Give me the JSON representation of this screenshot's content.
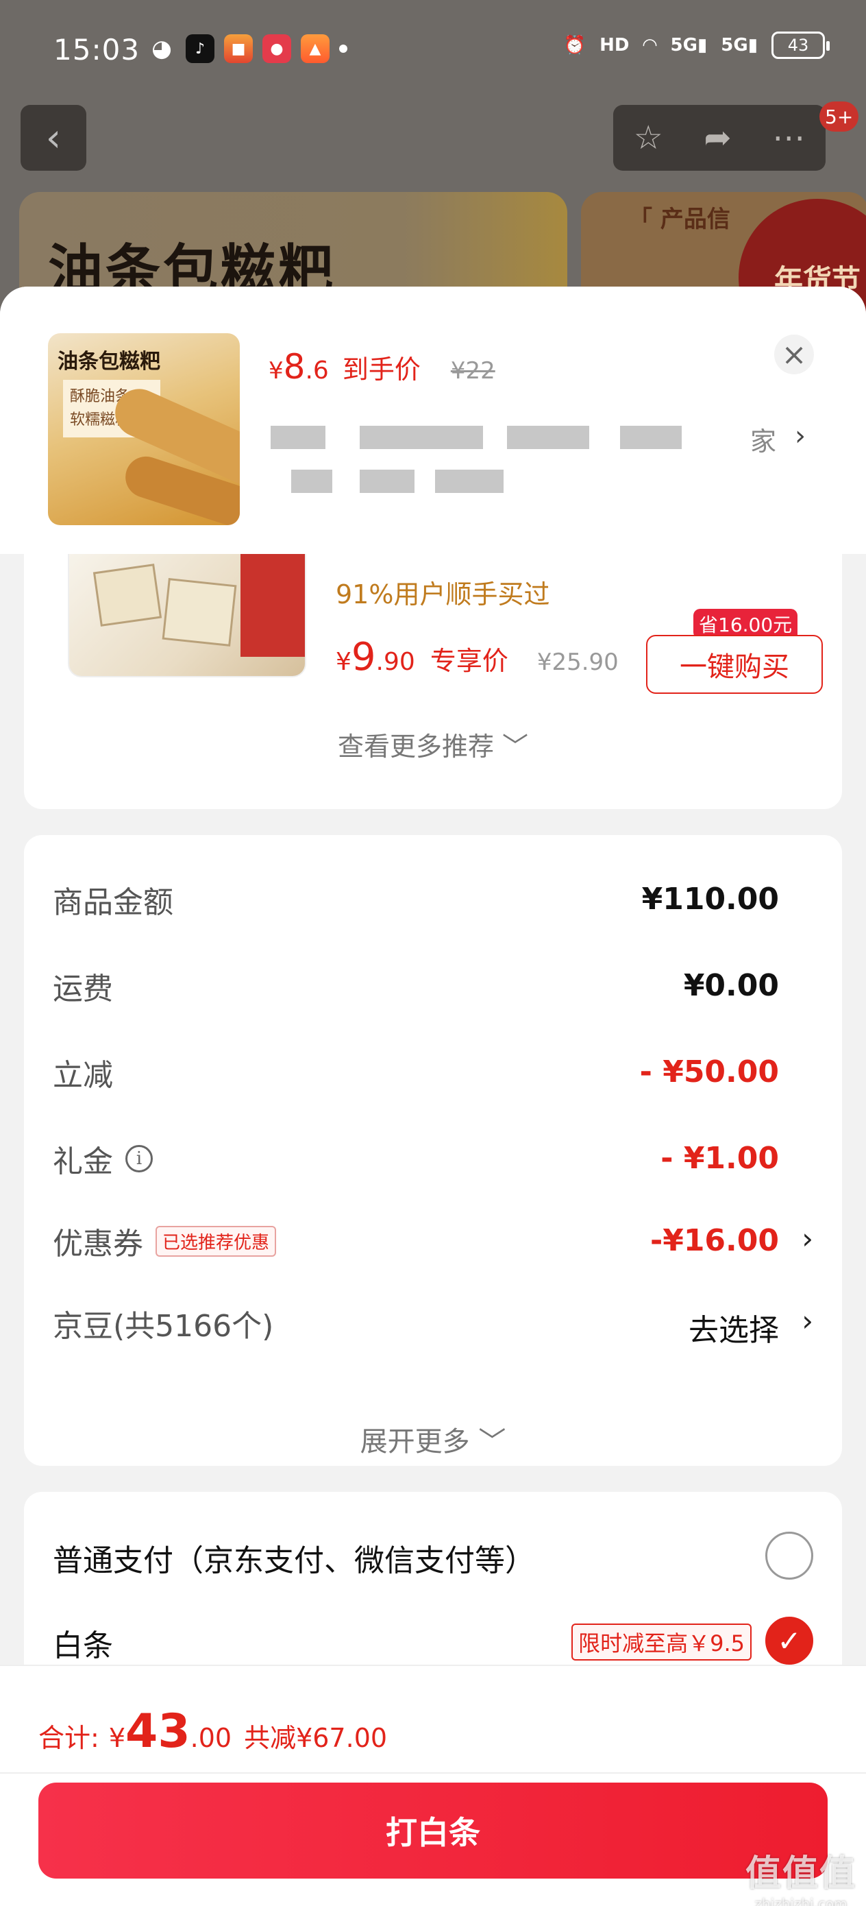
{
  "status_bar": {
    "time": "15:03",
    "battery": "43",
    "hd_label": "HD",
    "net1": "5G",
    "net2": "5G"
  },
  "header": {
    "back_icon": "chevron-left-icon",
    "cart_badge": "5+",
    "banner_title": "油条包糍粑",
    "banner2_title": "「 产品信",
    "banner2_seal": "年货节"
  },
  "product": {
    "thumb_title": "油条包糍粑",
    "thumb_sub1": "酥脆油条",
    "thumb_sub2": "软糯糍粑",
    "price_currency": "¥",
    "price_int": "8",
    "price_dec": ".6",
    "price_label": "到手价",
    "original_price": "¥22",
    "selection_suffix": "家"
  },
  "recommendation": {
    "stat": "91%用户顺手买过",
    "price_currency": "¥",
    "price_int": "9",
    "price_dec": ".90",
    "price_label": "专享价",
    "original_price": "¥25.90",
    "save_tag": "省16.00元",
    "buy_button": "一键购买",
    "more": "查看更多推荐 ﹀"
  },
  "amounts": {
    "goods_label": "商品金额",
    "goods_value": "¥110.00",
    "shipping_label": "运费",
    "shipping_value": "¥0.00",
    "instant_label": "立减",
    "instant_value": "- ¥50.00",
    "gift_label": "礼金",
    "gift_value": "- ¥1.00",
    "coupon_label": "优惠券",
    "coupon_chip": "已选推荐优惠",
    "coupon_value": "-¥16.00",
    "beans_label": "京豆(共5166个)",
    "beans_value": "去选择",
    "expand": "展开更多 ﹀"
  },
  "payment": {
    "normal_label": "普通支付（京东支付、微信支付等）",
    "baitiao_label": "白条",
    "baitiao_promo": "限时减至高￥9.5"
  },
  "footer": {
    "total_label": "合计:",
    "total_currency": "¥",
    "total_int": "43",
    "total_dec": ".00",
    "total_saving": "共减¥67.00",
    "pay_button": "打白条"
  },
  "watermark": {
    "line1": "值值值",
    "line2": "zhizhizhi.com"
  },
  "colors": {
    "accent_red": "#e2231a",
    "pay_button": "#f6314a",
    "orange_text": "#c07b1e"
  }
}
